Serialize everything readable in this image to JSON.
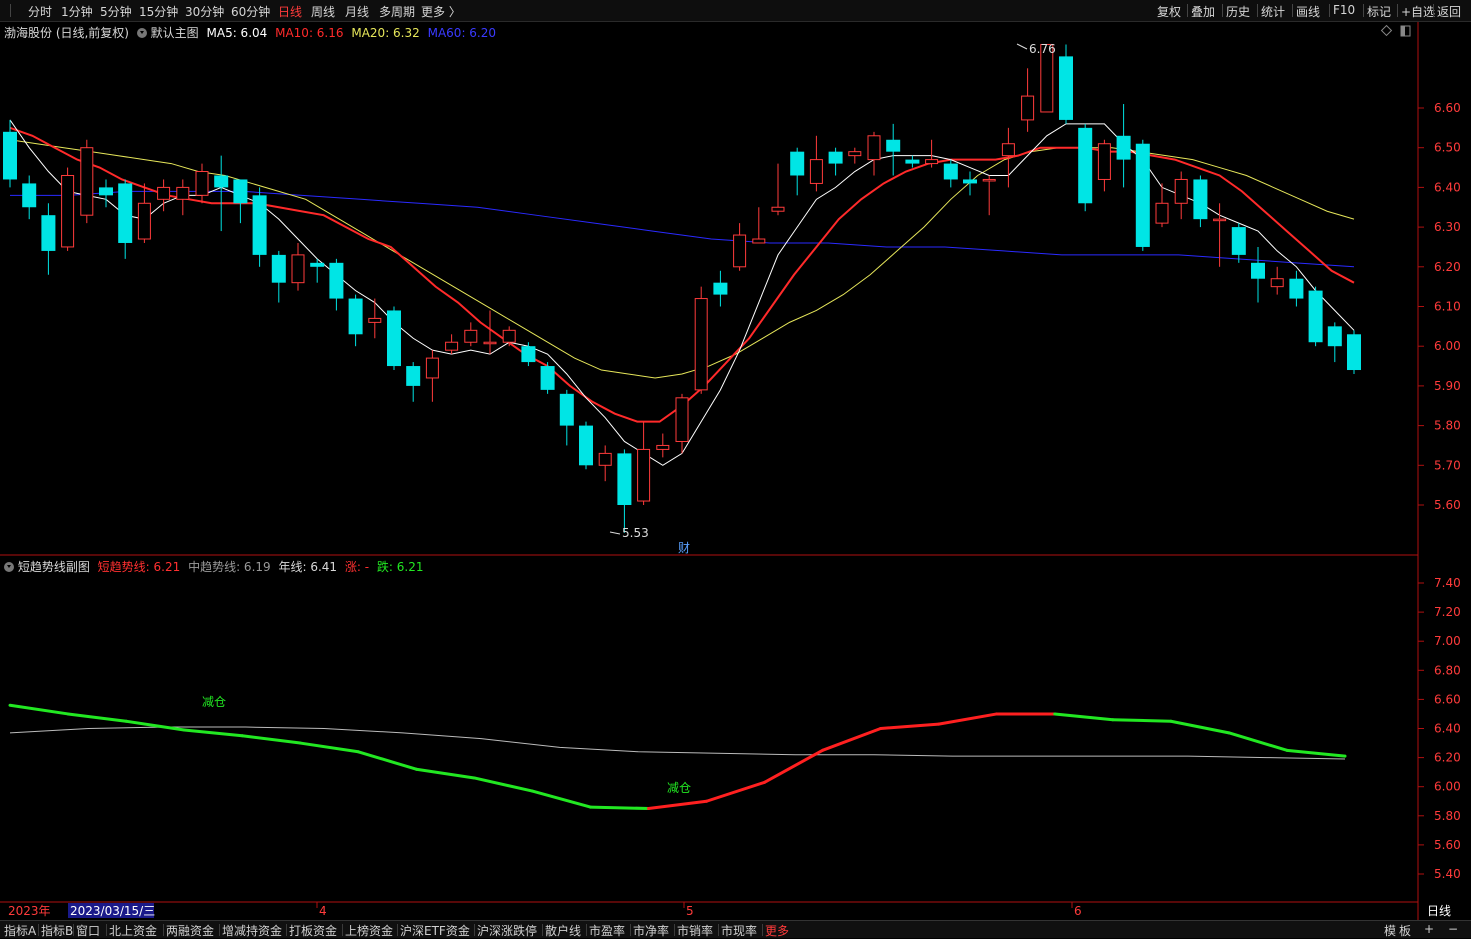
{
  "toolbar": {
    "periods": [
      "分时",
      "1分钟",
      "5分钟",
      "15分钟",
      "30分钟",
      "60分钟",
      "日线",
      "周线",
      "月线",
      "多周期",
      "更多 〉"
    ],
    "active_period": "日线",
    "right_buttons": [
      "复权",
      "叠加",
      "历史",
      "统计",
      "画线",
      "F10",
      "标记",
      "+自选",
      "返回"
    ]
  },
  "main_info": {
    "stock": "渤海股份 (日线,前复权)",
    "template": "默认主图",
    "ma5_label": "MA5: 6.04",
    "ma10_label": "MA10: 6.16",
    "ma20_label": "MA20: 6.32",
    "ma60_label": "MA60: 6.20",
    "high_label": "6.76",
    "low_label": "5.53",
    "finance_marker": "财"
  },
  "sub_info": {
    "name": "短趋势线副图",
    "short_label": "短趋势线: 6.21",
    "mid_label": "中趋势线: 6.19",
    "year_label": "年线: 6.41",
    "up_label": "涨: -",
    "down_label": "跌: 6.21",
    "signal1": "减仓",
    "signal2": "减仓"
  },
  "axis": {
    "year_label": "2023年",
    "cursor_date": "2023/03/15/三",
    "month_4": "4",
    "month_5": "5",
    "month_6": "6",
    "period_box": "日线"
  },
  "bottom_tabs": [
    "指标A",
    "指标B",
    "窗口",
    "北上资金",
    "两融资金",
    "增减持资金",
    "打板资金",
    "上榜资金",
    "沪深ETF资金",
    "沪深涨跌停",
    "散户线",
    "市盈率",
    "市净率",
    "市销率",
    "市现率",
    "更多"
  ],
  "bottom_right": [
    "模",
    "板",
    "+",
    "−"
  ],
  "colors": {
    "up": "#ff3b3b",
    "down": "#00e5e5",
    "ma5": "#ffffff",
    "ma10": "#ff2a2a",
    "ma20": "#e6e65a",
    "ma60": "#2a2aff",
    "trend_up": "#ff2020",
    "trend_down": "#22e822",
    "mid_trend": "#bbbbbb"
  },
  "chart_data": [
    {
      "type": "candlestick",
      "title": "渤海股份 (日线,前复权)",
      "y_ticks": [
        5.6,
        5.7,
        5.8,
        5.9,
        6.0,
        6.1,
        6.2,
        6.3,
        6.4,
        6.5,
        6.6
      ],
      "ylim": [
        5.5,
        6.7
      ],
      "candles": [
        [
          6.54,
          6.42,
          6.57,
          6.4
        ],
        [
          6.41,
          6.35,
          6.43,
          6.32
        ],
        [
          6.33,
          6.24,
          6.36,
          6.18
        ],
        [
          6.25,
          6.43,
          6.45,
          6.24
        ],
        [
          6.33,
          6.5,
          6.52,
          6.31
        ],
        [
          6.4,
          6.38,
          6.42,
          6.35
        ],
        [
          6.41,
          6.26,
          6.42,
          6.22
        ],
        [
          6.27,
          6.36,
          6.41,
          6.26
        ],
        [
          6.37,
          6.4,
          6.42,
          6.34
        ],
        [
          6.37,
          6.4,
          6.42,
          6.33
        ],
        [
          6.38,
          6.44,
          6.46,
          6.36
        ],
        [
          6.43,
          6.4,
          6.48,
          6.29
        ],
        [
          6.42,
          6.36,
          6.42,
          6.31
        ],
        [
          6.38,
          6.23,
          6.4,
          6.2
        ],
        [
          6.23,
          6.16,
          6.24,
          6.11
        ],
        [
          6.16,
          6.23,
          6.26,
          6.14
        ],
        [
          6.21,
          6.2,
          6.22,
          6.16
        ],
        [
          6.21,
          6.12,
          6.22,
          6.09
        ],
        [
          6.12,
          6.03,
          6.13,
          6.0
        ],
        [
          6.06,
          6.07,
          6.12,
          6.02
        ],
        [
          6.09,
          5.95,
          6.1,
          5.94
        ],
        [
          5.95,
          5.9,
          5.96,
          5.86
        ],
        [
          5.92,
          5.97,
          5.99,
          5.86
        ],
        [
          5.99,
          6.01,
          6.03,
          5.98
        ],
        [
          6.01,
          6.04,
          6.06,
          6.0
        ],
        [
          6.01,
          6.01,
          6.09,
          5.98
        ],
        [
          6.01,
          6.04,
          6.05,
          6.0
        ],
        [
          6.0,
          5.96,
          6.01,
          5.95
        ],
        [
          5.95,
          5.89,
          5.96,
          5.88
        ],
        [
          5.88,
          5.8,
          5.89,
          5.75
        ],
        [
          5.8,
          5.7,
          5.81,
          5.69
        ],
        [
          5.7,
          5.73,
          5.75,
          5.66
        ],
        [
          5.73,
          5.6,
          5.74,
          5.53
        ],
        [
          5.61,
          5.74,
          5.81,
          5.6
        ],
        [
          5.74,
          5.75,
          5.78,
          5.72
        ],
        [
          5.76,
          5.87,
          5.88,
          5.73
        ],
        [
          5.89,
          6.12,
          6.15,
          5.88
        ],
        [
          6.16,
          6.13,
          6.19,
          6.1
        ],
        [
          6.2,
          6.28,
          6.31,
          6.19
        ],
        [
          6.26,
          6.27,
          6.35,
          6.26
        ],
        [
          6.34,
          6.35,
          6.46,
          6.33
        ],
        [
          6.49,
          6.43,
          6.5,
          6.38
        ],
        [
          6.41,
          6.47,
          6.53,
          6.39
        ],
        [
          6.49,
          6.46,
          6.5,
          6.43
        ],
        [
          6.48,
          6.49,
          6.5,
          6.46
        ],
        [
          6.47,
          6.53,
          6.54,
          6.43
        ],
        [
          6.52,
          6.49,
          6.56,
          6.43
        ],
        [
          6.47,
          6.46,
          6.48,
          6.45
        ],
        [
          6.46,
          6.47,
          6.52,
          6.45
        ],
        [
          6.46,
          6.42,
          6.47,
          6.4
        ],
        [
          6.42,
          6.41,
          6.44,
          6.38
        ],
        [
          6.42,
          6.42,
          6.43,
          6.33
        ],
        [
          6.48,
          6.51,
          6.55,
          6.4
        ],
        [
          6.57,
          6.63,
          6.7,
          6.54
        ],
        [
          6.59,
          6.76,
          6.76,
          6.59
        ],
        [
          6.73,
          6.57,
          6.76,
          6.56
        ],
        [
          6.55,
          6.36,
          6.56,
          6.34
        ],
        [
          6.42,
          6.51,
          6.52,
          6.39
        ],
        [
          6.53,
          6.47,
          6.61,
          6.4
        ],
        [
          6.51,
          6.25,
          6.52,
          6.24
        ],
        [
          6.31,
          6.36,
          6.41,
          6.3
        ],
        [
          6.36,
          6.42,
          6.44,
          6.32
        ],
        [
          6.42,
          6.32,
          6.43,
          6.3
        ],
        [
          6.32,
          6.32,
          6.36,
          6.2
        ],
        [
          6.3,
          6.23,
          6.31,
          6.21
        ],
        [
          6.21,
          6.17,
          6.25,
          6.11
        ],
        [
          6.15,
          6.17,
          6.2,
          6.13
        ],
        [
          6.17,
          6.12,
          6.19,
          6.1
        ],
        [
          6.14,
          6.01,
          6.15,
          6.0
        ],
        [
          6.05,
          6.0,
          6.06,
          5.96
        ],
        [
          6.03,
          5.94,
          6.04,
          5.93
        ]
      ],
      "ma5": [
        6.57,
        6.5,
        6.44,
        6.39,
        6.38,
        6.37,
        6.33,
        6.32,
        6.36,
        6.38,
        6.38,
        6.4,
        6.38,
        6.36,
        6.32,
        6.27,
        6.22,
        6.18,
        6.14,
        6.11,
        6.06,
        6.02,
        5.99,
        5.98,
        5.99,
        5.98,
        6.01,
        6.0,
        5.98,
        5.93,
        5.87,
        5.82,
        5.76,
        5.73,
        5.7,
        5.73,
        5.81,
        5.89,
        5.99,
        6.11,
        6.23,
        6.3,
        6.37,
        6.4,
        6.44,
        6.47,
        6.48,
        6.48,
        6.48,
        6.47,
        6.45,
        6.43,
        6.43,
        6.48,
        6.53,
        6.56,
        6.56,
        6.56,
        6.51,
        6.47,
        6.4,
        6.38,
        6.36,
        6.33,
        6.31,
        6.29,
        6.24,
        6.2,
        6.14,
        6.09,
        6.04
      ],
      "ma10": [
        6.55,
        6.53,
        6.5,
        6.47,
        6.45,
        6.42,
        6.4,
        6.38,
        6.37,
        6.36,
        6.36,
        6.36,
        6.35,
        6.34,
        6.33,
        6.3,
        6.27,
        6.25,
        6.2,
        6.15,
        6.11,
        6.06,
        6.02,
        5.98,
        5.95,
        5.9,
        5.86,
        5.83,
        5.81,
        5.81,
        5.85,
        5.9,
        5.96,
        6.02,
        6.1,
        6.18,
        6.25,
        6.32,
        6.37,
        6.41,
        6.44,
        6.46,
        6.47,
        6.47,
        6.47,
        6.48,
        6.5,
        6.5,
        6.5,
        6.49,
        6.49,
        6.48,
        6.47,
        6.45,
        6.43,
        6.39,
        6.34,
        6.29,
        6.24,
        6.19,
        6.16
      ],
      "ma10_start": 0,
      "ma20": [
        6.52,
        6.51,
        6.5,
        6.49,
        6.48,
        6.47,
        6.46,
        6.44,
        6.43,
        6.41,
        6.39,
        6.37,
        6.33,
        6.29,
        6.25,
        6.21,
        6.17,
        6.13,
        6.09,
        6.05,
        6.01,
        5.97,
        5.94,
        5.93,
        5.92,
        5.93,
        5.95,
        5.98,
        6.02,
        6.06,
        6.09,
        6.13,
        6.18,
        6.24,
        6.3,
        6.37,
        6.43,
        6.47,
        6.49,
        6.5,
        6.5,
        6.5,
        6.49,
        6.48,
        6.47,
        6.45,
        6.43,
        6.4,
        6.37,
        6.34,
        6.32
      ],
      "ma20_start": 0,
      "ma60": [
        6.38,
        6.38,
        6.39,
        6.39,
        6.39,
        6.38,
        6.37,
        6.36,
        6.35,
        6.33,
        6.31,
        6.29,
        6.27,
        6.26,
        6.26,
        6.25,
        6.25,
        6.24,
        6.23,
        6.23,
        6.23,
        6.22,
        6.21,
        6.2
      ],
      "high": 6.76,
      "low": 5.53
    },
    {
      "type": "line",
      "title": "短趋势线副图",
      "y_ticks": [
        5.4,
        5.6,
        5.8,
        6.0,
        6.2,
        6.4,
        6.6,
        6.8,
        7.0,
        7.2,
        7.4
      ],
      "ylim": [
        5.3,
        7.5
      ],
      "series": [
        {
          "name": "短趋势线",
          "values": [
            6.56,
            6.5,
            6.45,
            6.39,
            6.35,
            6.3,
            6.24,
            6.12,
            6.06,
            5.97,
            5.86,
            5.85,
            5.9,
            6.03,
            6.25,
            6.4,
            6.43,
            6.5,
            6.5,
            6.46,
            6.45,
            6.37,
            6.25,
            6.21
          ],
          "up_segments": [
            [
              11,
              18
            ]
          ]
        },
        {
          "name": "中趋势线",
          "values": [
            6.37,
            6.4,
            6.41,
            6.41,
            6.4,
            6.37,
            6.33,
            6.27,
            6.24,
            6.23,
            6.22,
            6.22,
            6.21,
            6.21,
            6.21,
            6.21,
            6.2,
            6.19
          ]
        }
      ],
      "signals": [
        "减仓",
        "减仓"
      ]
    }
  ]
}
